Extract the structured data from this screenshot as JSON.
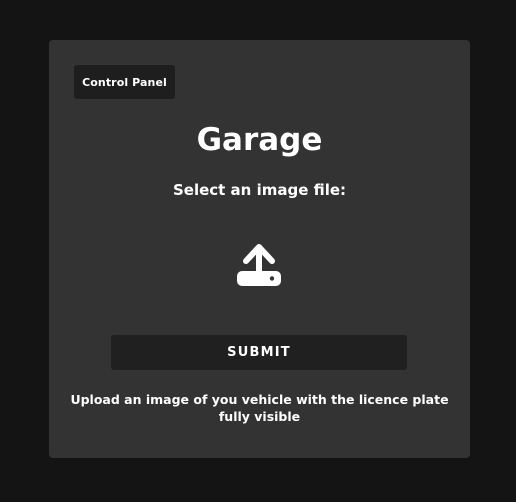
{
  "card": {
    "control_panel_label": "Control Panel",
    "title": "Garage",
    "prompt": "Select an image file:",
    "upload_icon": "upload-tray-icon",
    "submit_label": "SUBMIT",
    "hint": "Upload an image of you vehicle with the licence plate fully visible"
  },
  "colors": {
    "page_background": "#141414",
    "card_background": "#333333",
    "button_background": "#1e1e1e",
    "text": "#ffffff"
  }
}
